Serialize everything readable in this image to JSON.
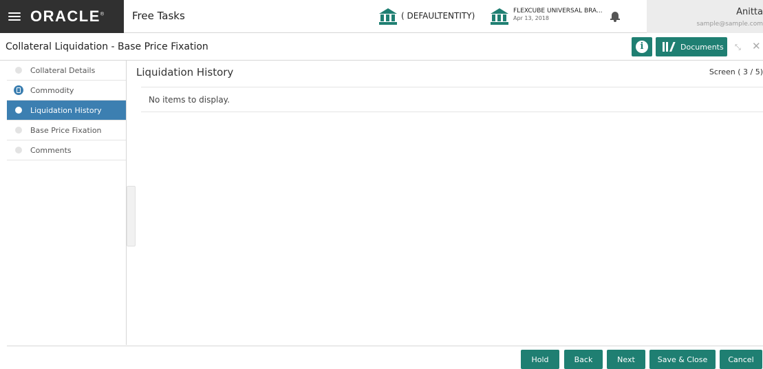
{
  "header": {
    "logo_text": "ORACLE",
    "logo_mark": "®",
    "app_title": "Free Tasks",
    "entity": "( DEFAULTENTITY)",
    "branch_name": "FLEXCUBE UNIVERSAL BRA...",
    "branch_date": "Apr 13, 2018",
    "user_name": "Anitta",
    "user_email": "sample@sample.com"
  },
  "subheader": {
    "page_title": "Collateral Liquidation - Base Price Fixation",
    "info_label": "i",
    "documents_label": "Documents",
    "minimize_glyph": "⤡",
    "close_glyph": "✕"
  },
  "sidebar": {
    "items": [
      {
        "label": "Collateral Details"
      },
      {
        "label": "Commodity"
      },
      {
        "label": "Liquidation History"
      },
      {
        "label": "Base Price Fixation"
      },
      {
        "label": "Comments"
      }
    ]
  },
  "main": {
    "title": "Liquidation History",
    "screen_counter": "Screen ( 3 / 5)",
    "empty_message": "No items to display."
  },
  "footer": {
    "hold": "Hold",
    "back": "Back",
    "next": "Next",
    "save_close": "Save & Close",
    "cancel": "Cancel"
  },
  "colors": {
    "accent_teal": "#1f7f72",
    "active_blue": "#3c7fb1",
    "brand_dark": "#303030"
  },
  "icons": [
    "menu-icon",
    "bank-icon",
    "bell-icon",
    "info-icon",
    "documents-icon",
    "minimize-icon",
    "close-icon"
  ]
}
